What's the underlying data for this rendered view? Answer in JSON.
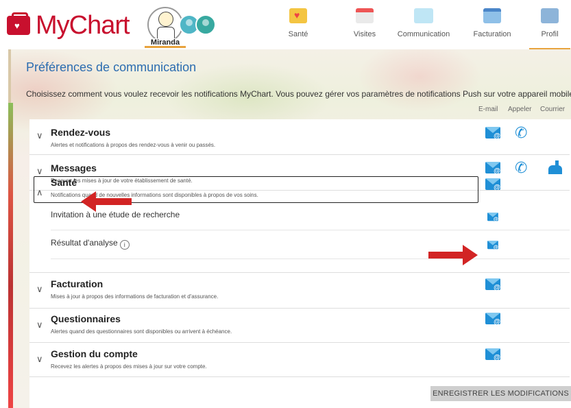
{
  "header": {
    "logo_text": "MyChart",
    "patient_name": "Miranda",
    "nav": [
      {
        "label": "Santé",
        "icon": "heart-folder-icon"
      },
      {
        "label": "Visites",
        "icon": "calendar-icon"
      },
      {
        "label": "Communication",
        "icon": "envelope-icon"
      },
      {
        "label": "Facturation",
        "icon": "credit-card-icon"
      },
      {
        "label": "Profil",
        "icon": "profile-card-icon"
      }
    ]
  },
  "page": {
    "title": "Préférences de communication",
    "intro": "Choisissez comment vous voulez recevoir les notifications MyChart. Vous pouvez gérer vos paramètres de notifications Push sur votre appareil mobile.",
    "columns": {
      "email": "E-mail",
      "appeler": "Appeler",
      "courrier": "Courrier"
    }
  },
  "sections": [
    {
      "title": "Rendez-vous",
      "desc": "Alertes et notifications à propos des rendez-vous à venir ou passés.",
      "expanded": false,
      "channels": [
        "email",
        "phone"
      ]
    },
    {
      "title": "Messages",
      "desc": "Recevez les mises à jour de votre établissement de santé.",
      "expanded": false,
      "channels": [
        "email",
        "phone",
        "mail"
      ]
    },
    {
      "title": "Santé",
      "desc": "Notifications quand de nouvelles informations sont disponibles à propos de vos soins.",
      "expanded": true,
      "channels": [
        "email"
      ],
      "subitems": [
        {
          "label": "Invitation à une étude de recherche",
          "channels": [
            "email"
          ]
        },
        {
          "label": "Résultat d'analyse",
          "info": "i",
          "channels": [
            "email"
          ]
        }
      ]
    },
    {
      "title": "Facturation",
      "desc": "Mises à jour à propos des informations de facturation et d'assurance.",
      "expanded": false,
      "channels": [
        "email"
      ]
    },
    {
      "title": "Questionnaires",
      "desc": "Alertes quand des questionnaires sont disponibles ou arrivent à échéance.",
      "expanded": false,
      "channels": [
        "email"
      ]
    },
    {
      "title": "Gestion du compte",
      "desc": "Recevez les alertes à propos des mises à jour sur votre compte.",
      "expanded": false,
      "channels": [
        "email"
      ]
    }
  ],
  "chevrons": {
    "collapsed": "∨",
    "expanded": "∧"
  },
  "save_button": "ENREGISTRER LES MODIFICATIONS",
  "colors": {
    "brand": "#c8102e",
    "link": "#2b6cb0",
    "icon": "#1f8fd6",
    "accent": "#e8a33d",
    "annotation_arrow": "#d22424"
  }
}
